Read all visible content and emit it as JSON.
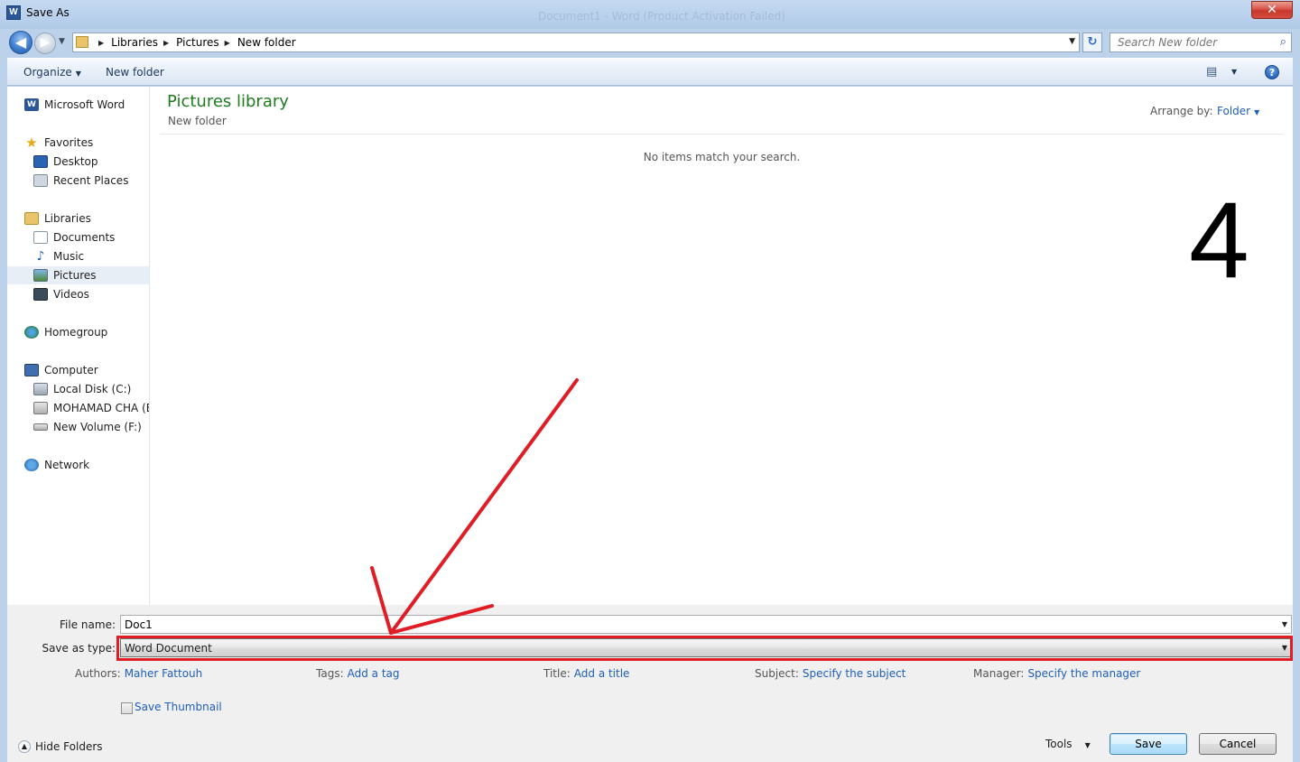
{
  "window": {
    "title": "Save As",
    "background_title": "Document1 - Word (Product Activation Failed)",
    "close_glyph": "✕",
    "app_icon_letter": "W"
  },
  "navigation": {
    "back_glyph": "◀",
    "forward_glyph": "▶",
    "breadcrumb": [
      "Libraries",
      "Pictures",
      "New folder"
    ],
    "search_placeholder": "Search New folder"
  },
  "toolbar": {
    "organize_label": "Organize",
    "new_folder_label": "New folder",
    "help_glyph": "?"
  },
  "sidebar": {
    "items": [
      {
        "label": "Microsoft Word",
        "icon": "word-icon"
      },
      {
        "label": "Favorites",
        "icon": "star-icon"
      },
      {
        "label": "Desktop",
        "icon": "desktop-icon"
      },
      {
        "label": "Recent Places",
        "icon": "recent-places-icon"
      },
      {
        "label": "Libraries",
        "icon": "libraries-icon"
      },
      {
        "label": "Documents",
        "icon": "documents-icon"
      },
      {
        "label": "Music",
        "icon": "music-icon"
      },
      {
        "label": "Pictures",
        "icon": "pictures-icon",
        "selected": true
      },
      {
        "label": "Videos",
        "icon": "videos-icon"
      },
      {
        "label": "Homegroup",
        "icon": "homegroup-icon"
      },
      {
        "label": "Computer",
        "icon": "computer-icon"
      },
      {
        "label": "Local Disk (C:)",
        "icon": "local-disk-icon"
      },
      {
        "label": "MOHAMAD CHA (E",
        "icon": "drive-icon"
      },
      {
        "label": "New Volume (F:)",
        "icon": "drive-icon"
      },
      {
        "label": "Network",
        "icon": "network-icon"
      }
    ]
  },
  "content": {
    "library_title": "Pictures library",
    "library_subtitle": "New folder",
    "arrange_label": "Arrange by:",
    "arrange_value": "Folder",
    "empty_message": "No items match your search.",
    "step_number": "4"
  },
  "form": {
    "file_name_label": "File name:",
    "file_name_value": "Doc1",
    "save_type_label": "Save as type:",
    "save_type_value": "Word Document",
    "authors_label": "Authors:",
    "authors_value": "Maher Fattouh",
    "tags_label": "Tags:",
    "tags_value": "Add a tag",
    "title_label": "Title:",
    "title_value": "Add a title",
    "subject_label": "Subject:",
    "subject_value": "Specify the subject",
    "manager_label": "Manager:",
    "manager_value": "Specify the manager",
    "thumbnail_label": "Save Thumbnail"
  },
  "footer": {
    "hide_folders_label": "Hide Folders",
    "tools_label": "Tools",
    "save_label": "Save",
    "cancel_label": "Cancel"
  },
  "colors": {
    "annotation_red": "#e01c24",
    "link_blue": "#1f5fb8",
    "library_green": "#1e7b1e"
  }
}
